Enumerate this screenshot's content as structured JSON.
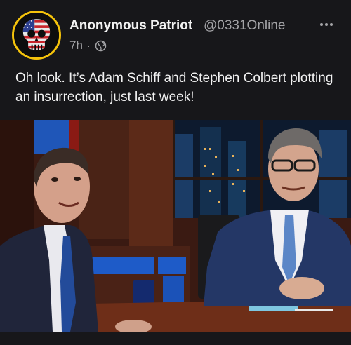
{
  "post": {
    "author_name": "Anonymous Patriot",
    "author_handle": "@0331Online",
    "timestamp": "7h",
    "separator": "·",
    "visibility_icon": "globe-icon",
    "more_icon": "more-options-icon",
    "text": "Oh look. It’s Adam Schiff and Stephen Colbert plotting an insurrection, just last week!",
    "avatar_icon": "skull-flag-avatar",
    "media": "talk-show-photo"
  },
  "colors": {
    "background": "#17171a",
    "text_primary": "#f2f2f2",
    "text_secondary": "#a3a3a6",
    "avatar_ring": "#f5c30b"
  }
}
